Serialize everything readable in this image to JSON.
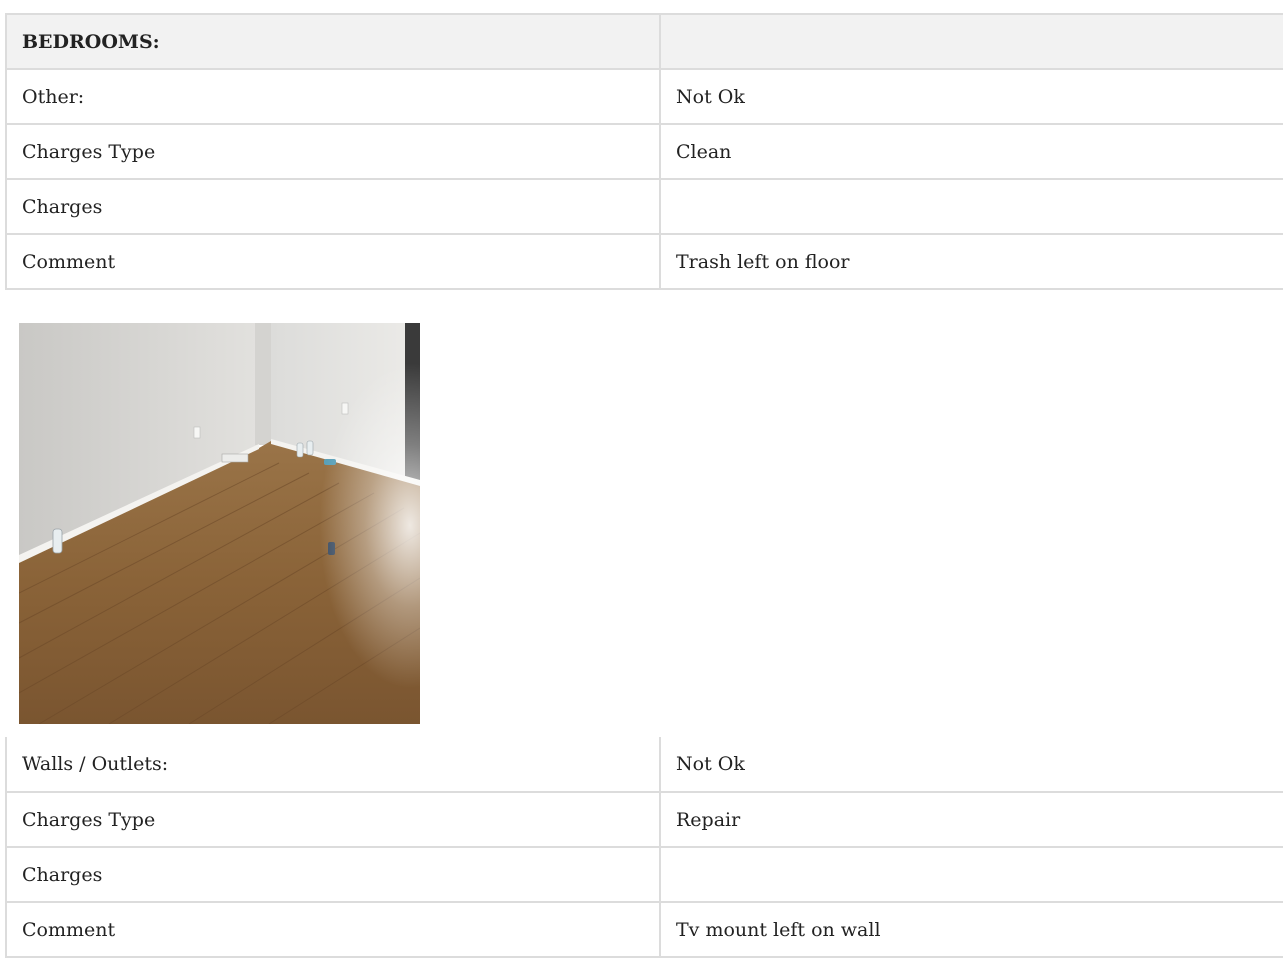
{
  "section_one": {
    "header_label": "BEDROOMS:",
    "header_value": "",
    "rows": [
      {
        "label": "Other:",
        "value": "Not Ok"
      },
      {
        "label": "Charges Type",
        "value": "Clean"
      },
      {
        "label": "Charges",
        "value": ""
      },
      {
        "label": "Comment",
        "value": "Trash left on floor"
      }
    ]
  },
  "photo": {
    "icon": "room-photo"
  },
  "section_two": {
    "rows": [
      {
        "label": "Walls / Outlets:",
        "value": "Not Ok"
      },
      {
        "label": "Charges Type",
        "value": "Repair"
      },
      {
        "label": "Charges",
        "value": ""
      },
      {
        "label": "Comment",
        "value": "Tv mount left on wall"
      }
    ]
  }
}
